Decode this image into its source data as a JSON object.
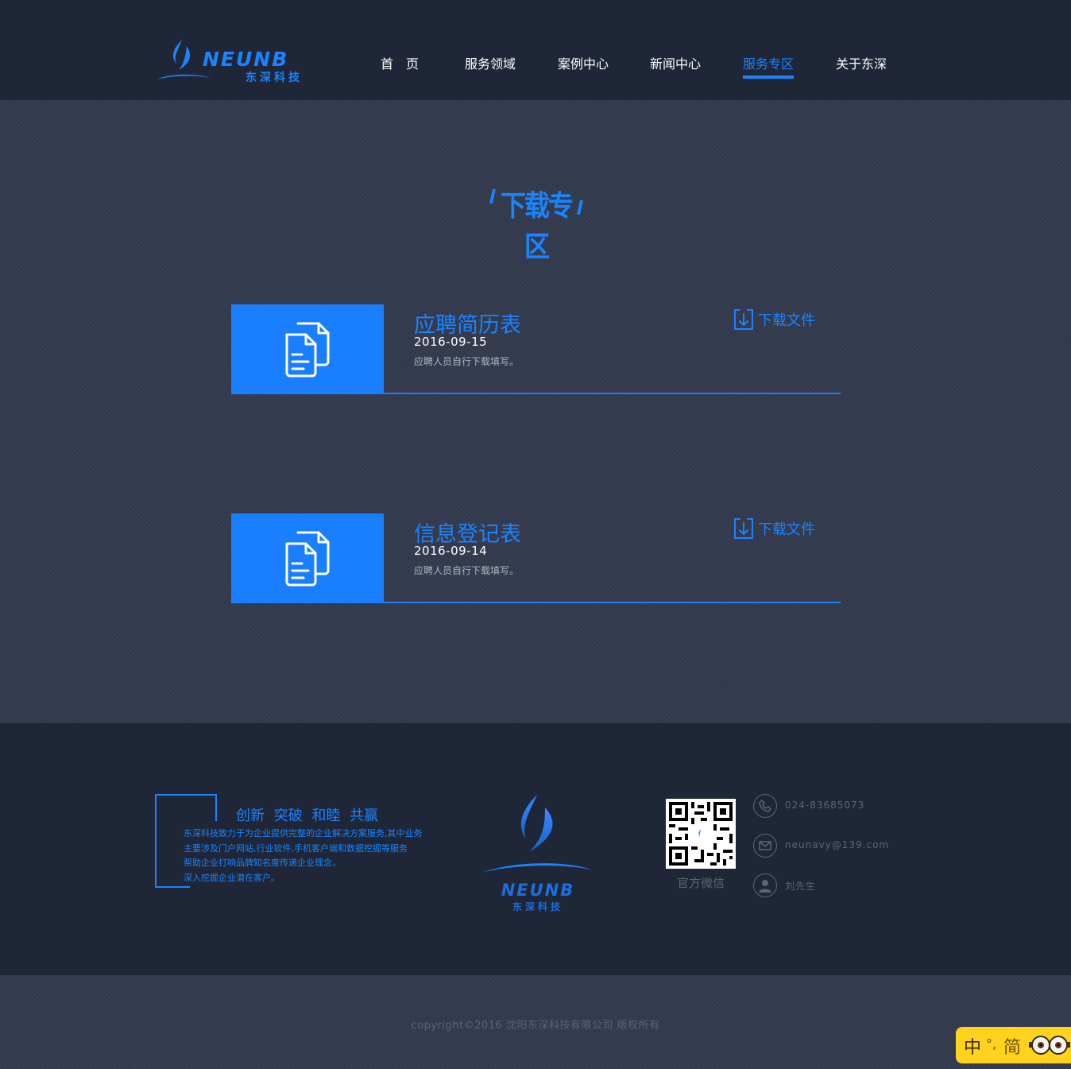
{
  "brand": {
    "name_en": "NEUNB",
    "name_zh": "东深科技"
  },
  "nav": {
    "items": [
      {
        "label": "首　页",
        "active": false
      },
      {
        "label": "服务领域",
        "active": false
      },
      {
        "label": "案例中心",
        "active": false
      },
      {
        "label": "新闻中心",
        "active": false
      },
      {
        "label": "服务专区",
        "active": true
      },
      {
        "label": "关于东深",
        "active": false
      }
    ]
  },
  "main": {
    "section_title": "下载专区",
    "downloads": [
      {
        "title": "应聘简历表",
        "date": "2016-09-15",
        "description": "应聘人员自行下载填写。",
        "action_label": "下载文件",
        "icon": "document-icon"
      },
      {
        "title": "信息登记表",
        "date": "2016-09-14",
        "description": "应聘人员自行下载填写。",
        "action_label": "下载文件",
        "icon": "document-icon"
      }
    ]
  },
  "footer": {
    "slogan": "创新 突破 和睦 共赢",
    "about_lines": [
      "东深科技致力于为企业提供完整的企业解决方案服务,其中业务",
      "主要涉及门户网站,行业软件,手机客户端和数据挖掘等服务",
      "帮助企业打响品牌知名度传递企业理念，",
      "深入挖掘企业潜在客户。"
    ],
    "qr_label": "官方微信",
    "contacts": [
      {
        "icon": "phone-icon",
        "text": "024-83685073"
      },
      {
        "icon": "mail-icon",
        "text": "neunavy@139.com"
      },
      {
        "icon": "person-icon",
        "text": "刘先生"
      }
    ]
  },
  "copyright": "copyright©2016 沈阳东深科技有限公司 版权所有",
  "ime": {
    "lang": "中",
    "punct": "°,",
    "mode": "简"
  },
  "colors": {
    "accent": "#1a84ff",
    "header_bg": "#1f2637",
    "body_bg": "#333a4d",
    "card_blue": "#1a7ffe"
  }
}
